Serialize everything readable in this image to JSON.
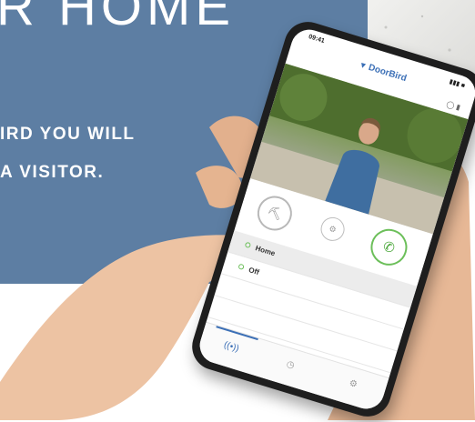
{
  "banner": {
    "title": "R HOME",
    "line1": "IRD YOU WILL",
    "line2": "A VISITOR."
  },
  "phone": {
    "time": "09:41",
    "signal": "▮▮▮ ■",
    "brand": "DoorBird",
    "controls": {
      "key_icon": "key-icon",
      "mid_icon": "settings-icon",
      "call_icon": "phone-icon"
    },
    "list": [
      {
        "label": "Home",
        "selected": true
      },
      {
        "label": "Off",
        "selected": false
      }
    ],
    "tabs": [
      "broadcast-icon",
      "history-icon",
      "settings-icon"
    ]
  },
  "colors": {
    "banner": "#5d7ea3",
    "accent_green": "#6cbf5a",
    "brand_blue": "#3b6fb6"
  }
}
